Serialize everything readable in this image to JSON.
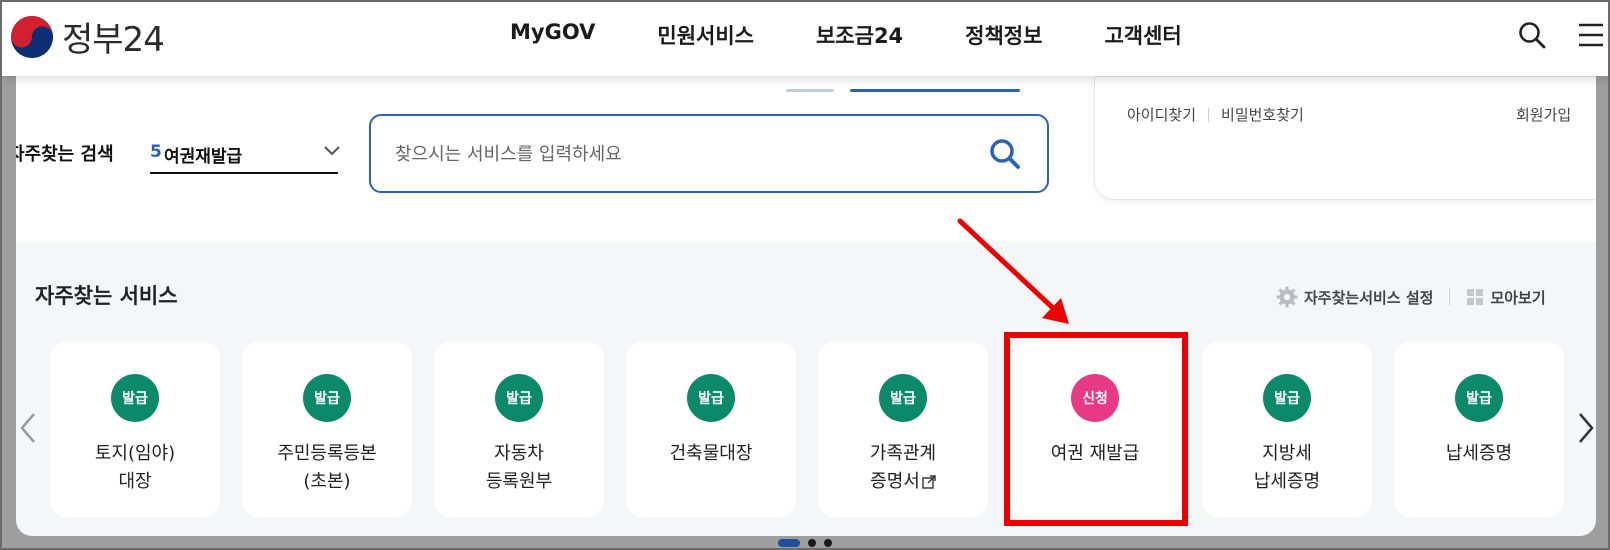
{
  "header": {
    "logo_text": "정부24",
    "nav": [
      "MyGOV",
      "민원서비스",
      "보조금24",
      "정책정보",
      "고객센터"
    ],
    "search_icon": "search-icon",
    "menu_icon": "hamburger-menu-icon"
  },
  "login": {
    "find_id": "아이디찾기",
    "find_password": "비밀번호찾기",
    "signup": "회원가입"
  },
  "frequent_search": {
    "label": "자주찾는 검색",
    "selected_rank": "5",
    "selected_keyword": "여권재발급",
    "chevron_icon": "chevron-down-icon"
  },
  "search": {
    "placeholder": "찾으시는 서비스를 입력하세요",
    "icon": "search-icon"
  },
  "services": {
    "title": "자주찾는 서비스",
    "settings_label": "자주찾는서비스 설정",
    "view_all_label": "모아보기",
    "items": [
      {
        "badge": "발급",
        "line1": "토지(임야)",
        "line2": "대장"
      },
      {
        "badge": "발급",
        "line1": "주민등록등본",
        "line2": "(초본)"
      },
      {
        "badge": "발급",
        "line1": "자동차",
        "line2": "등록원부"
      },
      {
        "badge": "발급",
        "line1": "건축물대장",
        "line2": ""
      },
      {
        "badge": "발급",
        "line1": "가족관계",
        "line2": "증명서"
      },
      {
        "badge": "신청",
        "line1": "여권 재발급",
        "line2": ""
      },
      {
        "badge": "발급",
        "line1": "지방세",
        "line2": "납세증명"
      },
      {
        "badge": "발급",
        "line1": "납세증명",
        "line2": ""
      }
    ]
  },
  "colors": {
    "brand_blue": "#2a62b8",
    "badge_green": "#0b8a6a",
    "badge_pink": "#e83a84",
    "annotation_red": "#ee0000"
  }
}
